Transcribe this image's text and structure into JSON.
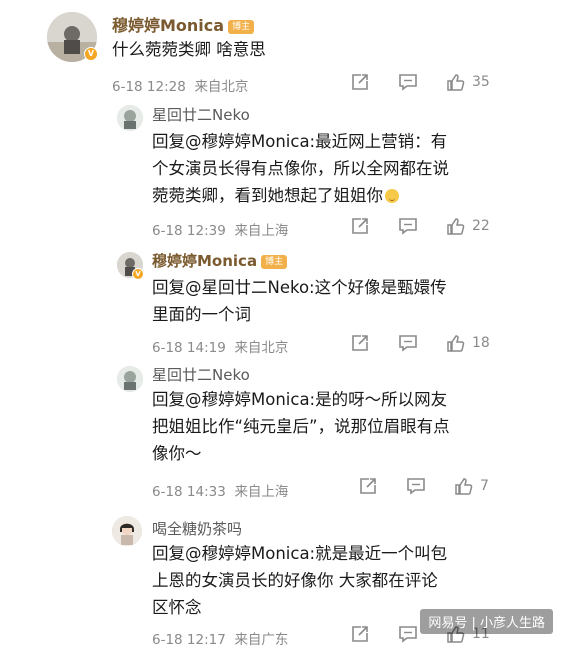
{
  "comments": [
    {
      "username": "穆婷婷Monica",
      "badge": "博主",
      "text": "什么菀菀类卿 啥意思",
      "date": "6-18 12:28",
      "location": "来自北京",
      "likes": "35"
    },
    {
      "username": "星回廿二Neko",
      "text_lines": [
        "回复@穆婷婷Monica:最近网上营销：有",
        "个女演员长得有点像你，所以全网都在说",
        "菀菀类卿，看到她想起了姐姐你"
      ],
      "date": "6-18 12:39",
      "location": "来自上海",
      "likes": "22"
    },
    {
      "username": "穆婷婷Monica",
      "badge": "博主",
      "text_lines": [
        "回复@星回廿二Neko:这个好像是甄嬛传",
        "里面的一个词"
      ],
      "date": "6-18 14:19",
      "location": "来自北京",
      "likes": "18"
    },
    {
      "username": "星回廿二Neko",
      "text_lines": [
        "回复@穆婷婷Monica:是的呀～所以网友",
        "把姐姐比作“纯元皇后”，说那位眉眼有点",
        "像你～"
      ],
      "date": "6-18 14:33",
      "location": "来自上海",
      "likes": "7"
    },
    {
      "username": "喝全糖奶茶吗",
      "text_lines": [
        "回复@穆婷婷Monica:就是最近一个叫包",
        "上恩的女演员长的好像你   大家都在评论",
        "区怀念"
      ],
      "date": "6-18 12:17",
      "location": "来自广东",
      "likes": "11"
    }
  ],
  "watermark": "网易号 | 小彦人生路",
  "icons": [
    "share-icon",
    "comment-icon",
    "like-icon"
  ],
  "colors": {
    "tag": "#f2b04a",
    "username_main": "#7a5a2e",
    "meta": "#8a8a8a"
  }
}
